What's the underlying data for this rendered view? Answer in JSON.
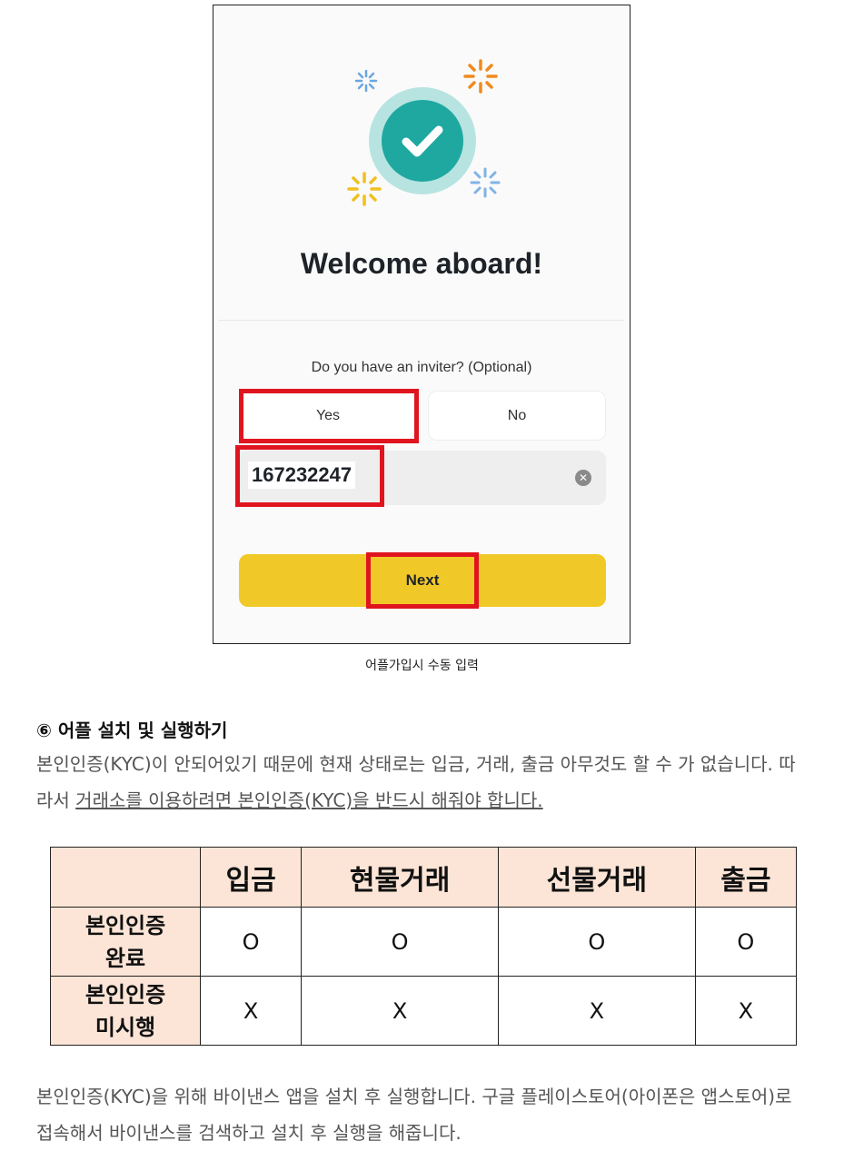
{
  "screen": {
    "welcome": "Welcome aboard!",
    "question": "Do you have an inviter? (Optional)",
    "yes_label": "Yes",
    "no_label": "No",
    "inviter_code": "167232247",
    "next_label": "Next",
    "accent_colors": {
      "teal": "#1fa8a0",
      "yellow": "#f0c929",
      "highlight_red": "#e0141e"
    }
  },
  "caption": "어플가입시 수동 입력",
  "section": {
    "heading": "⑥ 어플 설치 및 실행하기",
    "para1_a": "본인인증(KYC)이 안되어있기 때문에 현재 상태로는 입금, 거래, 출금 아무것도 할 수 가 없습니다. 따라서 ",
    "para1_b": "거래소를 이용하려면 본인인증(KYC)을 반드시 해줘야 합니다.",
    "para2": "본인인증(KYC)을 위해 바이낸스 앱을 설치 후 실행합니다. 구글 플레이스토어(아이폰은 앱스토어)로 접속해서 바이낸스를 검색하고 설치 후 실행을 해줍니다."
  },
  "table": {
    "headers": [
      "",
      "입금",
      "현물거래",
      "선물거래",
      "출금"
    ],
    "rows": [
      {
        "label_1": "본인인증",
        "label_2": "완료",
        "cells": [
          "O",
          "O",
          "O",
          "O"
        ]
      },
      {
        "label_1": "본인인증",
        "label_2": "미시행",
        "cells": [
          "X",
          "X",
          "X",
          "X"
        ]
      }
    ]
  }
}
